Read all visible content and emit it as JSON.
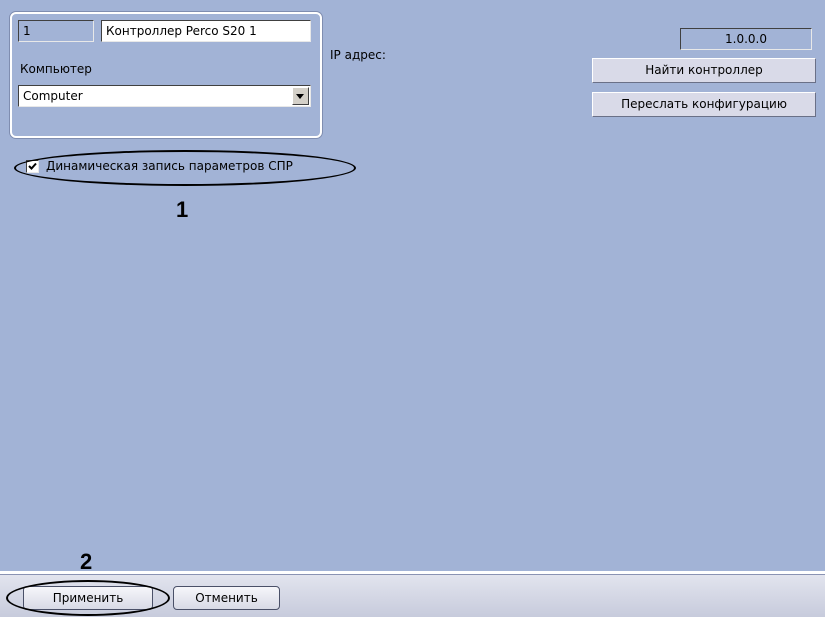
{
  "controller": {
    "id_value": "1",
    "name_value": "Контроллер Perco S20 1",
    "computer_label": "Компьютер",
    "computer_selected": "Computer"
  },
  "network": {
    "ip_label": "IP адрес:",
    "ip_value": "1.0.0.0",
    "find_button": "Найти контроллер",
    "send_button": "Переслать конфигурацию"
  },
  "options": {
    "dynamic_write_label": "Динамическая запись параметров СПР",
    "dynamic_write_checked": true
  },
  "annotations": {
    "marker1": "1",
    "marker2": "2"
  },
  "footer": {
    "apply_button": "Применить",
    "cancel_button": "Отменить"
  },
  "icons": {
    "checkbox_check": "check-icon",
    "dropdown_arrow": "chevron-down-icon"
  },
  "colors": {
    "panel_background": "#a2b3d6",
    "button_face": "#d9dae8"
  }
}
